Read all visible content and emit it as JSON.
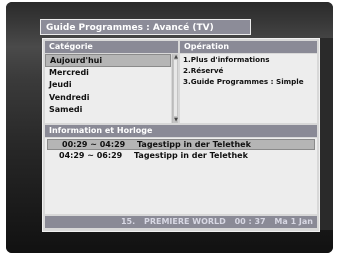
{
  "window": {
    "title": "Guide Programmes : Avancé (TV)"
  },
  "categories": {
    "header": "Catégorie",
    "items": [
      {
        "label": "Aujourd'hui",
        "selected": true
      },
      {
        "label": "Mercredi",
        "selected": false
      },
      {
        "label": "Jeudi",
        "selected": false
      },
      {
        "label": "Vendredi",
        "selected": false
      },
      {
        "label": "Samedi",
        "selected": false
      }
    ]
  },
  "operation": {
    "header": "Opération",
    "items": [
      {
        "label": "1.Plus d'informations"
      },
      {
        "label": "2.Réservé"
      },
      {
        "label": "3.Guide Programmes : Simple"
      }
    ]
  },
  "info": {
    "header": "Information et Horloge",
    "rows": [
      {
        "time": "00:29 ~ 04:29",
        "title": "Tagestipp in der Telethek",
        "selected": true
      },
      {
        "time": "04:29 ~ 06:29",
        "title": "Tagestipp in der Telethek",
        "selected": false
      }
    ]
  },
  "status": {
    "channel_number": "15.",
    "channel_name": "PREMIERE WORLD",
    "time": "00 : 37",
    "date": "Ma  1 Jan"
  },
  "colors": {
    "header_bg": "#8a8a96",
    "panel_bg": "#d8d8d8",
    "list_bg": "#ededed",
    "selection_bg": "#b5b5b5"
  }
}
